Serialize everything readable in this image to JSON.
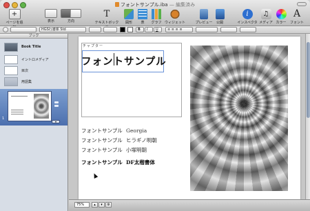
{
  "window": {
    "title": "フォントサンプル.iba",
    "edited": "— 編集済み"
  },
  "toolbar": {
    "add_page_label": "ページを追加",
    "view_label": "表示",
    "orientation_label": "方向",
    "textbox_label": "テキストボックス",
    "shape_label": "図形",
    "table_label": "表",
    "chart_label": "グラフ",
    "widget_label": "ウィジェット",
    "preview_label": "プレビュー",
    "publish_label": "公開",
    "inspector_label": "インスペクタ",
    "media_label": "メディア",
    "colors_label": "カラー",
    "fonts_label": "フォント",
    "add_glyph": "+",
    "textbox_glyph": "T",
    "info_glyph": "i",
    "font_glyph": "A"
  },
  "formatbar": {
    "style_value": "",
    "font_value": "HGS行書体 Std",
    "size_value": "",
    "spacing_value": "",
    "text_color": "#000000",
    "fill_color": "#ffffff"
  },
  "sidebar": {
    "header": "ブック",
    "items": [
      {
        "label": "Book Title"
      },
      {
        "label": "イントロメディア"
      },
      {
        "label": "目次"
      },
      {
        "label": "用語集"
      }
    ],
    "page_number": "1"
  },
  "page": {
    "chapter_label": "チャプター",
    "title_text": "フォントサンプル",
    "samples": [
      {
        "jp": "フォントサンプル",
        "font": "Georgia"
      },
      {
        "jp": "フォントサンプル",
        "font": "ヒラギノ明朝"
      },
      {
        "jp": "フォントサンプル",
        "font": "小塚明朝"
      },
      {
        "jp": "フォントサンプル",
        "font": "DF太楷書体"
      }
    ]
  },
  "statusbar": {
    "zoom_value": "75%"
  }
}
